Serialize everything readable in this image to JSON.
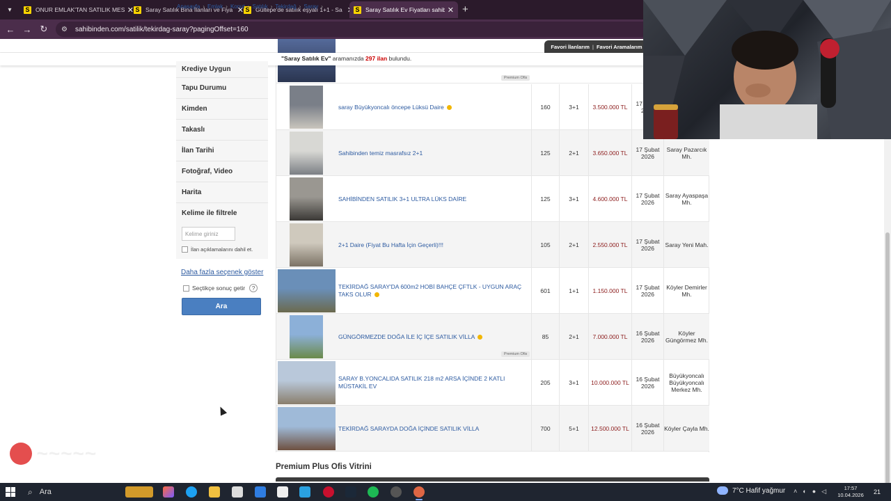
{
  "browser": {
    "tabs": [
      {
        "label": "ONUR EMLAK'TAN SATILIK MES",
        "active": false
      },
      {
        "label": "Saray Satılık Bina İlanları ve Fiya",
        "active": false
      },
      {
        "label": "Gültepe'de satılık eşyalı 1+1 - Sa",
        "active": false
      },
      {
        "label": "Saray Satılık Ev Fiyatları sahibind",
        "active": true
      }
    ],
    "favicon_letter": "S",
    "url": "sahibinden.com/satilik/tekirdag-saray?pagingOffset=160"
  },
  "breadcrumb": [
    "Anasayfa",
    "Emlak",
    "Konut",
    "Satılık",
    "Tekirdağ",
    "Saray"
  ],
  "favorites": {
    "favori_ilanlarim": "Favori İlanlarım",
    "favori_aramalarim": "Favori Aramalarım",
    "sep": "|"
  },
  "result": {
    "query": "\"Saray Satılık Ev\"",
    "middle": "aramanızda",
    "count": "297 ilan",
    "suffix": "bulundu."
  },
  "sidebar": {
    "filters": [
      "Krediye Uygun",
      "Tapu Durumu",
      "Kimden",
      "Takaslı",
      "İlan Tarihi",
      "Fotoğraf, Video",
      "Harita"
    ],
    "keyword_title": "Kelime ile filtrele",
    "keyword_placeholder": "Kelime giriniz",
    "keyword_check": "İlan açıklamalarını dahil et.",
    "more_options": "Daha fazla seçenek göster",
    "select_check": "Seçtikçe sonuç getir",
    "help": "?",
    "search_button": "Ara"
  },
  "listings": [
    {
      "title": "saray Büyükyoncalı öncepe Lüksü Daire",
      "shine": true,
      "m2": "160",
      "rooms": "3+1",
      "price": "3.500.000 TL",
      "date": "17 Şubat 2026",
      "loc": "",
      "premium": false
    },
    {
      "title": "Sahibinden temiz masrafsız 2+1",
      "shine": false,
      "m2": "125",
      "rooms": "2+1",
      "price": "3.650.000 TL",
      "date": "17 Şubat 2026",
      "loc": "Saray Pazarcık Mh.",
      "premium": false
    },
    {
      "title": "SAHİBİNDEN SATILIK 3+1 ULTRA LÜKS DAİRE",
      "shine": false,
      "m2": "125",
      "rooms": "3+1",
      "price": "4.600.000 TL",
      "date": "17 Şubat 2026",
      "loc": "Saray Ayaspaşa Mh.",
      "premium": false
    },
    {
      "title": "2+1 Daire (Fiyat Bu Hafta İçin Geçerli)!!!",
      "shine": false,
      "m2": "105",
      "rooms": "2+1",
      "price": "2.550.000 TL",
      "date": "17 Şubat 2026",
      "loc": "Saray Yeni Mah.",
      "premium": false
    },
    {
      "title": "TEKİRDAĞ SARAY'DA 600m2 HOBİ BAHÇE ÇFTLK - UYGUN ARAÇ TAKS OLUR",
      "shine": true,
      "m2": "601",
      "rooms": "1+1",
      "price": "1.150.000 TL",
      "date": "17 Şubat 2026",
      "loc": "Köyler Demirler Mh.",
      "premium": false
    },
    {
      "title": "GÜNGÖRMEZDE DOĞA İLE İÇ İÇE SATILIK VİLLA",
      "shine": true,
      "m2": "85",
      "rooms": "2+1",
      "price": "7.000.000 TL",
      "date": "16 Şubat 2026",
      "loc": "Köyler Güngörmez Mh.",
      "premium": true
    },
    {
      "title": "SARAY B.YONCALIDA SATILIK 218 m2 ARSA İÇİNDE 2 KATLI MÜSTAKİL EV",
      "shine": false,
      "m2": "205",
      "rooms": "3+1",
      "price": "10.000.000 TL",
      "date": "16 Şubat 2026",
      "loc": "Büyükyoncalı Büyükyoncalı Merkez Mh.",
      "premium": false
    },
    {
      "title": "TEKİRDAĞ SARAYDA DOĞA İÇİNDE SATILIK VİLLA",
      "shine": false,
      "m2": "700",
      "rooms": "5+1",
      "price": "12.500.000 TL",
      "date": "16 Şubat 2026",
      "loc": "Köyler Çayla Mh.",
      "premium": false
    }
  ],
  "premium_label": "Premium Ofis",
  "premium_vitrin": "Premium Plus Ofis Vitrini",
  "taskbar": {
    "search": "Ara",
    "weather": "7°C  Hafif yağmur",
    "time": "17:57",
    "date": "10.04.2026",
    "notif": "21"
  },
  "colors": {
    "link": "#2c5aa0",
    "price": "#8b1a1a",
    "button": "#4a7fc1",
    "tab_bar": "#2b1a2b",
    "toolbar": "#4b2d4b"
  }
}
